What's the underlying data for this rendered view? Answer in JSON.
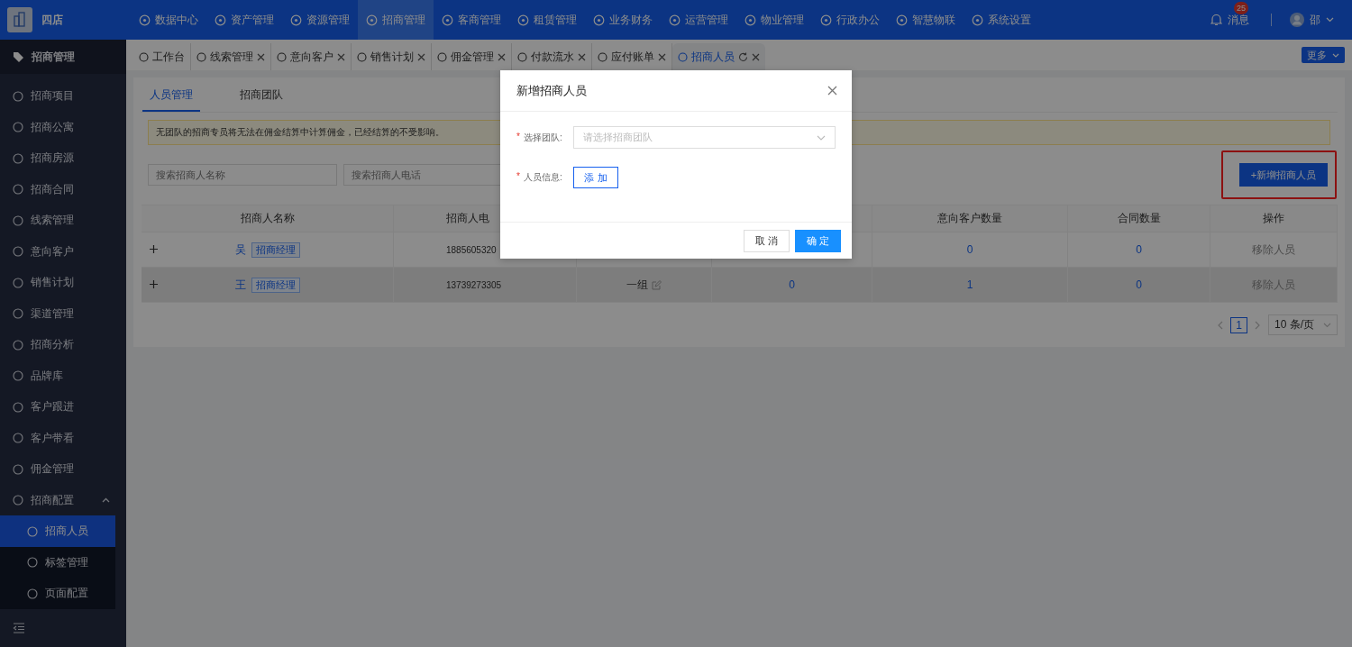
{
  "brand": {
    "name": "四店"
  },
  "top_nav": [
    {
      "label": "数据中心",
      "selected": false
    },
    {
      "label": "资产管理",
      "selected": false
    },
    {
      "label": "资源管理",
      "selected": false
    },
    {
      "label": "招商管理",
      "selected": true
    },
    {
      "label": "客商管理",
      "selected": false
    },
    {
      "label": "租赁管理",
      "selected": false
    },
    {
      "label": "业务财务",
      "selected": false
    },
    {
      "label": "运营管理",
      "selected": false
    },
    {
      "label": "物业管理",
      "selected": false
    },
    {
      "label": "行政办公",
      "selected": false
    },
    {
      "label": "智慧物联",
      "selected": false
    },
    {
      "label": "系统设置",
      "selected": false
    }
  ],
  "header_right": {
    "messages": "消息",
    "badge": "25",
    "user": "邵"
  },
  "sidebar": {
    "title": "招商管理",
    "items": [
      {
        "label": "招商项目",
        "selected": false
      },
      {
        "label": "招商公寓",
        "selected": false
      },
      {
        "label": "招商房源",
        "selected": false
      },
      {
        "label": "招商合同",
        "selected": false
      },
      {
        "label": "线索管理",
        "selected": false
      },
      {
        "label": "意向客户",
        "selected": false
      },
      {
        "label": "销售计划",
        "selected": false
      },
      {
        "label": "渠道管理",
        "selected": false
      },
      {
        "label": "招商分析",
        "selected": false
      },
      {
        "label": "品牌库",
        "selected": false
      },
      {
        "label": "客户跟进",
        "selected": false
      },
      {
        "label": "客户带看",
        "selected": false
      },
      {
        "label": "佣金管理",
        "selected": false
      },
      {
        "label": "招商配置",
        "selected": false,
        "expanded": true,
        "children": [
          {
            "label": "招商人员",
            "selected": true
          },
          {
            "label": "标签管理",
            "selected": false
          },
          {
            "label": "页面配置",
            "selected": false
          }
        ]
      }
    ]
  },
  "page_tabs": [
    {
      "label": "工作台",
      "selected": false,
      "closable": false
    },
    {
      "label": "线索管理",
      "selected": false,
      "closable": true
    },
    {
      "label": "意向客户",
      "selected": false,
      "closable": true
    },
    {
      "label": "销售计划",
      "selected": false,
      "closable": true
    },
    {
      "label": "佣金管理",
      "selected": false,
      "closable": true
    },
    {
      "label": "付款流水",
      "selected": false,
      "closable": true
    },
    {
      "label": "应付账单",
      "selected": false,
      "closable": true
    },
    {
      "label": "招商人员",
      "selected": true,
      "closable": true
    }
  ],
  "more_button": "更多",
  "sub_tabs": [
    {
      "label": "人员管理",
      "selected": true
    },
    {
      "label": "招商团队",
      "selected": false
    }
  ],
  "notice": "无团队的招商专员将无法在佣金结算中计算佣金，已经结算的不受影响。",
  "search": [
    {
      "placeholder": "搜索招商人名称"
    },
    {
      "placeholder": "搜索招商人电话"
    }
  ],
  "add_button": "+新增招商人员",
  "table": {
    "columns": [
      "招商人名称",
      "招商人电",
      "",
      "",
      "意向客户数量",
      "合同数量",
      "操作"
    ],
    "rows": [
      {
        "highlighted": false,
        "name": "吴",
        "tag": "招商经理",
        "phone": "1885605320",
        "team": "",
        "column_4": "",
        "intent": "0",
        "contracts": "0",
        "action": "移除人员"
      },
      {
        "highlighted": true,
        "name": "王",
        "tag": "招商经理",
        "phone": "13739273305",
        "team": "一组",
        "column_4": "0",
        "intent": "1",
        "contracts": "0",
        "action": "移除人员"
      }
    ]
  },
  "pagination": {
    "page": "1",
    "page_size": "10 条/页"
  },
  "dialog": {
    "title": "新增招商人员",
    "fields": [
      {
        "label": "选择团队:",
        "required_mark": "*",
        "kind": "select",
        "placeholder": "请选择招商团队"
      },
      {
        "label": "人员信息:",
        "required_mark": "*",
        "kind": "button",
        "button": "添 加"
      }
    ],
    "buttons": [
      {
        "label": "取 消",
        "kind": "default"
      },
      {
        "label": "确 定",
        "kind": "primary"
      }
    ]
  }
}
